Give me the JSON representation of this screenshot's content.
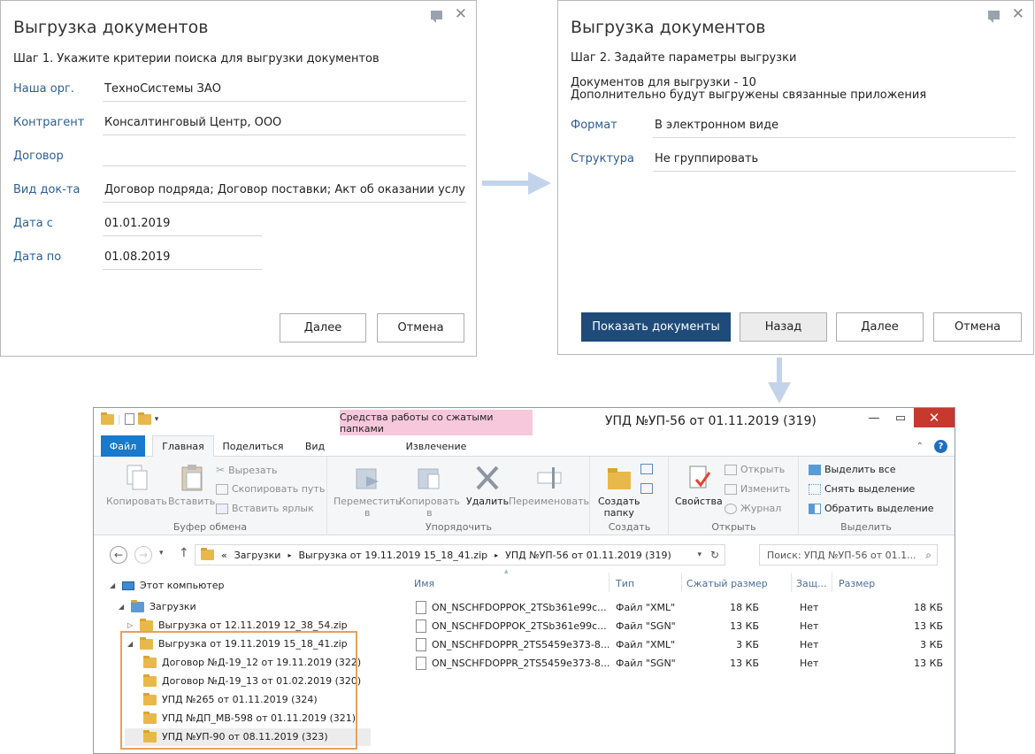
{
  "dialog1": {
    "title": "Выгрузка документов",
    "step": "Шаг 1. Укажите критерии поиска для выгрузки документов",
    "fields": [
      {
        "label": "Наша орг.",
        "value": "ТехноСистемы ЗАО"
      },
      {
        "label": "Контрагент",
        "value": "Консалтинговый Центр, ООО"
      },
      {
        "label": "Договор",
        "value": ""
      },
      {
        "label": "Вид док-та",
        "value": "Договор подряда; Договор поставки; Акт об оказании услуг (вы"
      },
      {
        "label": "Дата с",
        "value": "01.01.2019"
      },
      {
        "label": "Дата по",
        "value": "01.08.2019"
      }
    ],
    "next_label": "Далее",
    "cancel_label": "Отмена"
  },
  "dialog2": {
    "title": "Выгрузка документов",
    "step": "Шаг 2. Задайте параметры выгрузки",
    "docs_count": "Документов для выгрузки - 10",
    "docs_note": "Дополнительно будут выгружены связанные приложения",
    "fields": [
      {
        "label": "Формат",
        "value": "В электронном виде"
      },
      {
        "label": "Структура",
        "value": "Не группировать"
      }
    ],
    "show_label": "Показать документы",
    "back_label": "Назад",
    "next_label": "Далее",
    "cancel_label": "Отмена"
  },
  "explorer": {
    "title": "УПД №УП-56 от 01.11.2019 (319)",
    "context_tab": "Средства работы со сжатыми папками",
    "tabs": {
      "file": "Файл",
      "home": "Главная",
      "share": "Поделиться",
      "view": "Вид",
      "extract": "Извлечение"
    },
    "ribbon": {
      "copy": "Копировать",
      "paste": "Вставить",
      "cut": "Вырезать",
      "copy_path": "Скопировать путь",
      "paste_shortcut": "Вставить ярлык",
      "clipboard": "Буфер обмена",
      "move_to": "Переместить",
      "copy_to": "Копировать",
      "in": "в",
      "delete": "Удалить",
      "rename": "Переименовать",
      "organize": "Упорядочить",
      "new_folder_1": "Создать",
      "new_folder_2": "папку",
      "create": "Создать",
      "properties": "Свойства",
      "open": "Открыть",
      "edit": "Изменить",
      "history": "Журнал",
      "open_group": "Открыть",
      "select_all": "Выделить все",
      "select_none": "Снять выделение",
      "invert": "Обратить выделение",
      "select_group": "Выделить"
    },
    "address": {
      "prefix": "«",
      "crumbs": [
        "Загрузки",
        "Выгрузка от 19.11.2019 15_18_41.zip",
        "УПД №УП-56 от 01.11.2019 (319)"
      ]
    },
    "search_placeholder": "Поиск: УПД №УП-56 от 01.1...",
    "tree": [
      "Этот компьютер",
      "Загрузки",
      "Выгрузка от 12.11.2019 12_38_54.zip",
      "Выгрузка от 19.11.2019 15_18_41.zip",
      "Договор №Д-19_12 от 19.11.2019 (322)",
      "Договор №Д-19_13 от 01.02.2019 (320)",
      "УПД №265 от 01.11.2019 (324)",
      "УПД №ДП_МВ-598 от 01.11.2019 (321)",
      "УПД №УП-90 от 08.11.2019 (323)"
    ],
    "columns": [
      "Имя",
      "Тип",
      "Сжатый размер",
      "Защ...",
      "Размер"
    ],
    "files": [
      {
        "name": "ON_NSCHFDOPPOK_2TSb361e99c...",
        "type": "Файл \"XML\"",
        "packed": "18 КБ",
        "protected": "Нет",
        "size": "18 КБ"
      },
      {
        "name": "ON_NSCHFDOPPOK_2TSb361e99c...",
        "type": "Файл \"SGN\"",
        "packed": "13 КБ",
        "protected": "Нет",
        "size": "13 КБ"
      },
      {
        "name": "ON_NSCHFDOPPR_2TS5459e373-8...",
        "type": "Файл \"XML\"",
        "packed": "3 КБ",
        "protected": "Нет",
        "size": "3 КБ"
      },
      {
        "name": "ON_NSCHFDOPPR_2TS5459e373-8...",
        "type": "Файл \"SGN\"",
        "packed": "13 КБ",
        "protected": "Нет",
        "size": "13 КБ"
      }
    ]
  },
  "colors": {
    "accent": "#1e4b7a",
    "label": "#2c5f93",
    "arrow": "#c3d4ea",
    "highlight": "#e8a15c"
  }
}
